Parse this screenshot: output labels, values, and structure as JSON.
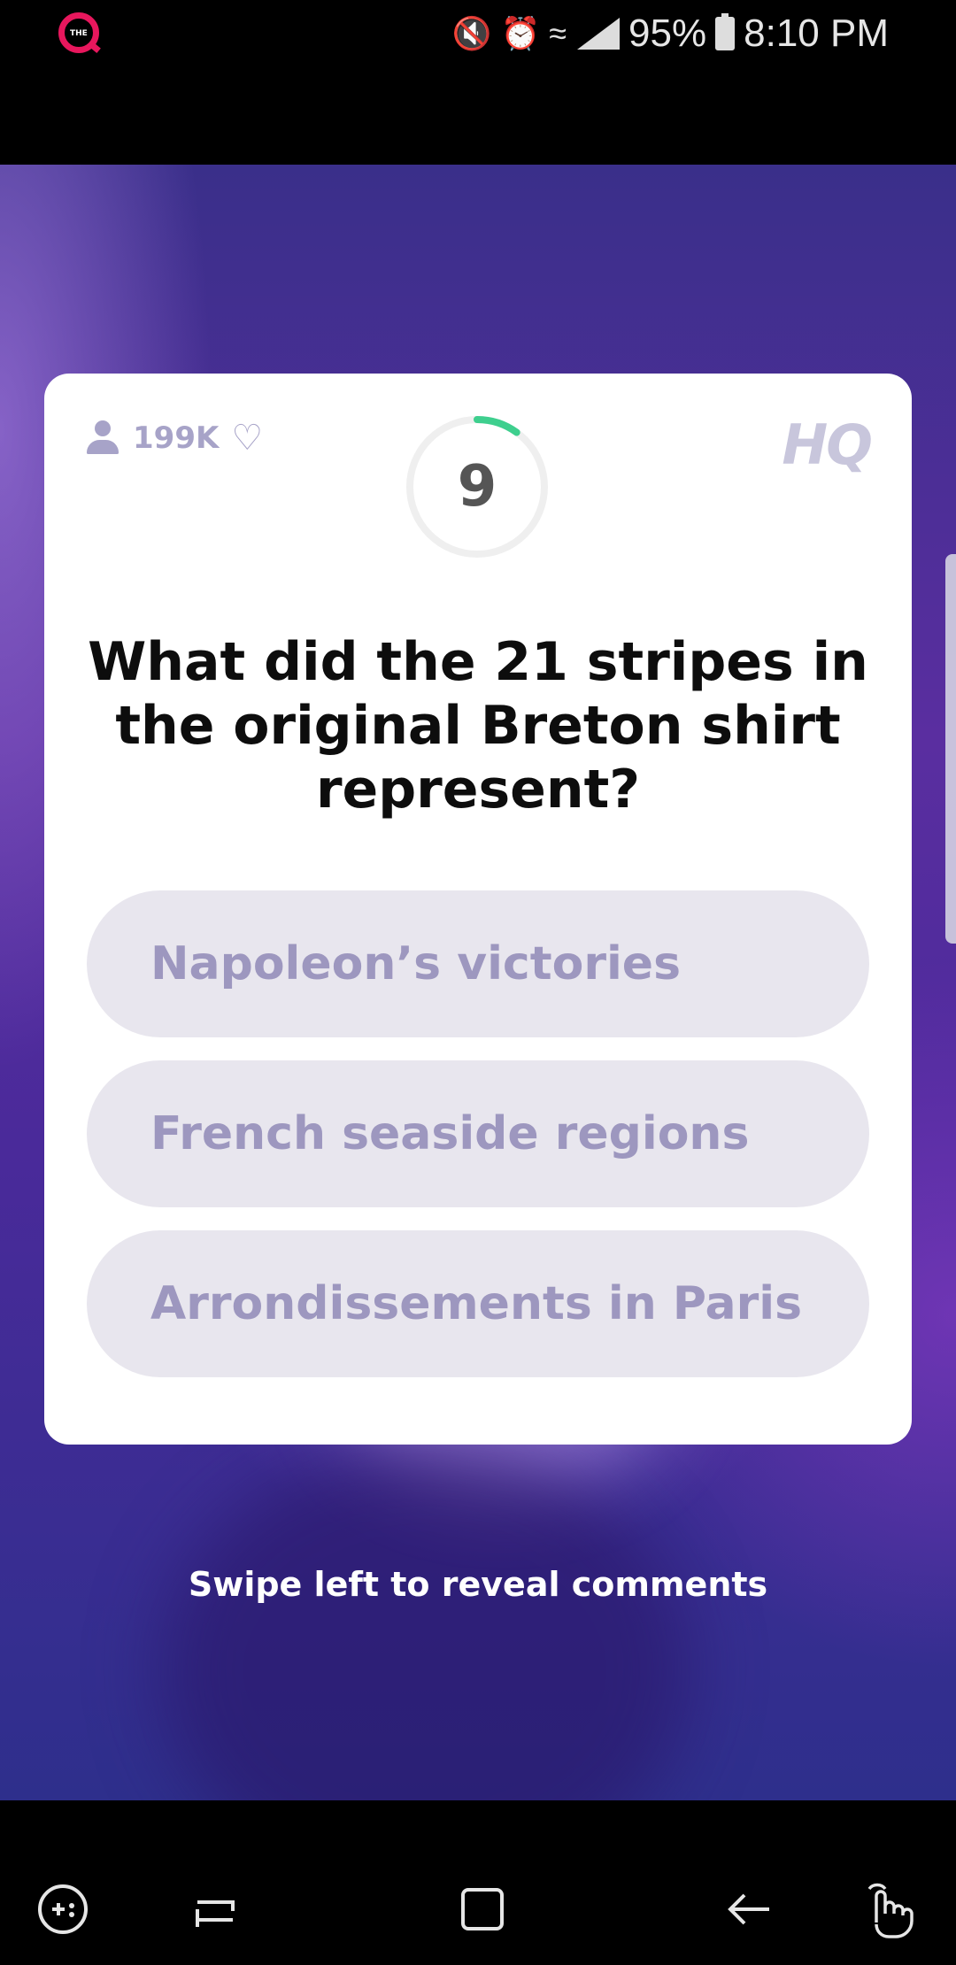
{
  "status_bar": {
    "app_badge": "THE",
    "battery_percent": "95%",
    "time": "8:10 PM",
    "icons": [
      "mute-icon",
      "alarm-icon",
      "wifi-icon",
      "signal-icon",
      "battery-icon"
    ]
  },
  "card": {
    "viewer_count": "199K",
    "timer_value": "9",
    "timer_remaining_fraction": 0.1,
    "brand": "HQ",
    "question": "What did the 21 stripes in the original Breton shirt represent?",
    "answers": [
      {
        "label": "Napoleon’s victories"
      },
      {
        "label": "French seaside regions"
      },
      {
        "label": "Arrondissements in Paris"
      }
    ]
  },
  "footer": {
    "swipe_hint": "Swipe left to reveal comments"
  },
  "nav_bar": {
    "icons": [
      "game-launcher-icon",
      "recents-icon",
      "home-icon",
      "back-icon",
      "gesture-icon"
    ]
  },
  "colors": {
    "timer_accent": "#3ecf8e",
    "answer_bg": "#e8e6ee",
    "answer_text": "#9d97bf",
    "brand_pink": "#e8175d"
  }
}
